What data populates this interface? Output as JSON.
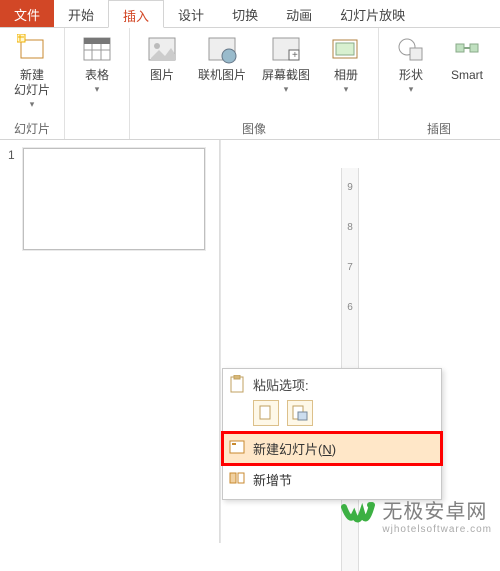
{
  "tabs": {
    "file": "文件",
    "home": "开始",
    "insert": "插入",
    "design": "设计",
    "transition": "切换",
    "animation": "动画",
    "slideshow": "幻灯片放映"
  },
  "ribbon": {
    "new_slide": "新建\n幻灯片",
    "table": "表格",
    "picture": "图片",
    "online_picture": "联机图片",
    "screenshot": "屏幕截图",
    "album": "相册",
    "shape": "形状",
    "smart": "Smart"
  },
  "groups": {
    "slides": "幻灯片",
    "images": "图像",
    "illus": "插图"
  },
  "slide_num": "1",
  "ruler_ticks": [
    "9",
    "8",
    "7",
    "6"
  ],
  "context_menu": {
    "paste_header": "粘贴选项:",
    "new_slide_prefix": "新建幻灯片(",
    "new_slide_mnemonic": "N",
    "new_slide_suffix": ")",
    "new_section_partial": "新增节"
  },
  "watermark": {
    "main": "无极安卓网",
    "sub": "wjhotelsoftware.com"
  }
}
